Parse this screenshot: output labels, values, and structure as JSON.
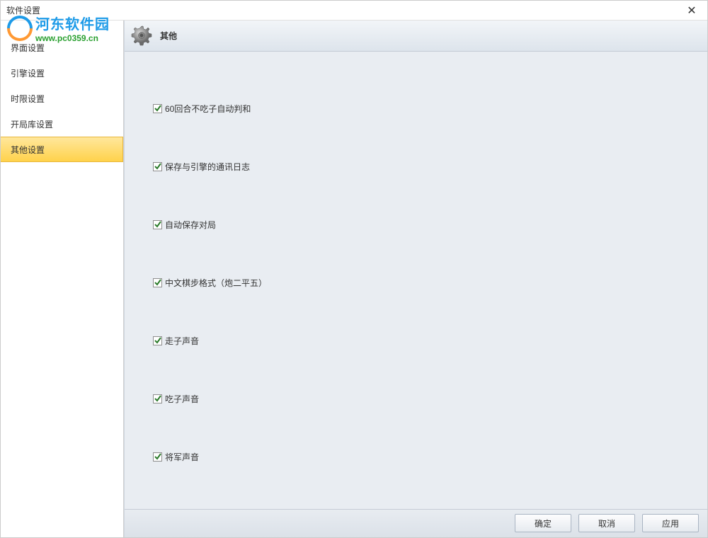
{
  "window": {
    "title": "软件设置"
  },
  "watermark": {
    "name": "河东软件园",
    "url": "www.pc0359.cn"
  },
  "sidebar": {
    "items": [
      {
        "label": "界面设置",
        "active": false
      },
      {
        "label": "引擎设置",
        "active": false
      },
      {
        "label": "时限设置",
        "active": false
      },
      {
        "label": "开局库设置",
        "active": false
      },
      {
        "label": "其他设置",
        "active": true
      }
    ]
  },
  "content": {
    "header_title": "其他",
    "options": [
      {
        "label": "60回合不吃子自动判和",
        "checked": true
      },
      {
        "label": "保存与引擎的通讯日志",
        "checked": true
      },
      {
        "label": "自动保存对局",
        "checked": true
      },
      {
        "label": "中文棋步格式（炮二平五）",
        "checked": true
      },
      {
        "label": "走子声音",
        "checked": true
      },
      {
        "label": "吃子声音",
        "checked": true
      },
      {
        "label": "将军声音",
        "checked": true
      }
    ]
  },
  "footer": {
    "ok": "确定",
    "cancel": "取消",
    "apply": "应用"
  }
}
